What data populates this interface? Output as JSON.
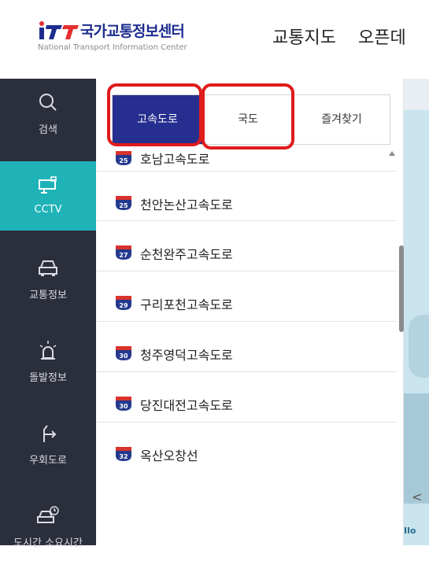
{
  "header": {
    "logo_title": "국가교통정보센터",
    "logo_subtitle": "National Transport Information Center",
    "nav": [
      "교통지도",
      "오픈데"
    ]
  },
  "sidebar": {
    "items": [
      {
        "label": "검색",
        "icon": "search-icon",
        "active": false
      },
      {
        "label": "CCTV",
        "icon": "cctv-icon",
        "active": true
      },
      {
        "label": "교통정보",
        "icon": "car-icon",
        "active": false
      },
      {
        "label": "돌발정보",
        "icon": "alert-siren-icon",
        "active": false
      },
      {
        "label": "우회도로",
        "icon": "detour-arrow-icon",
        "active": false
      },
      {
        "label": "도시간 소요시간",
        "icon": "car-clock-icon",
        "active": false
      }
    ]
  },
  "tabs": [
    "고속도로",
    "국도",
    "즐겨찾기"
  ],
  "roads": [
    {
      "num": "25",
      "name": "호남고속도로"
    },
    {
      "num": "25",
      "name": "천안논산고속도로"
    },
    {
      "num": "27",
      "name": "순천완주고속도로"
    },
    {
      "num": "29",
      "name": "구리포천고속도로"
    },
    {
      "num": "30",
      "name": "청주영덕고속도로"
    },
    {
      "num": "30",
      "name": "당진대전고속도로"
    },
    {
      "num": "32",
      "name": "옥산오창선"
    }
  ],
  "map": {
    "prev_arrow": "<",
    "label": "Ilo"
  },
  "colors": {
    "brand": "#1d2d8f",
    "sidebar_bg": "#2b2f3b",
    "active_teal": "#1fb3b8",
    "tab_active": "#262e8f",
    "highlight": "#e01b1b",
    "shield_red": "#d8332b",
    "shield_blue": "#24398e"
  }
}
